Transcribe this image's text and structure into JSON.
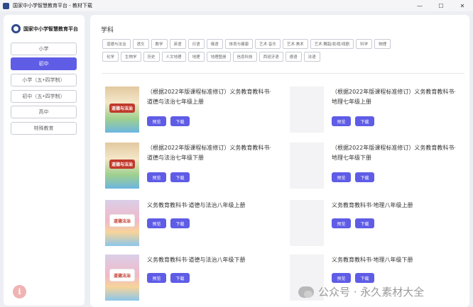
{
  "window": {
    "title": "国家中小学智慧教育平台 - 教材下载",
    "controls": {
      "minimize": "—",
      "maximize": "☐",
      "close": "✕"
    }
  },
  "sidebar": {
    "brand": "国家中小学智慧教育平台",
    "items": [
      {
        "label": "小学",
        "active": false
      },
      {
        "label": "初中",
        "active": true
      },
      {
        "label": "小学（五•四学制）",
        "active": false
      },
      {
        "label": "初中（五•四学制）",
        "active": false
      },
      {
        "label": "高中",
        "active": false
      },
      {
        "label": "特殊教育",
        "active": false
      }
    ],
    "info_icon": "i"
  },
  "main": {
    "section_title": "学科",
    "subject_row1": [
      "道德与法治",
      "语文",
      "数学",
      "英语",
      "日语",
      "俄语",
      "体育与健康",
      "艺术·音乐",
      "艺术·美术",
      "艺术·舞蹈/影视/戏剧",
      "科学",
      "物理"
    ],
    "subject_row2": [
      "化学",
      "生物学",
      "历史",
      "人文地理",
      "地理",
      "地理图册",
      "信息科技",
      "西班牙语",
      "德语",
      "法语"
    ],
    "books": [
      {
        "title": "（根据2022年版课程标准修订）义务教育教科书·道德与法治七年级上册",
        "cover_label": "道德与法治"
      },
      {
        "title": "（根据2022年版课程标准修订）义务教育教科书·地理七年级上册",
        "cover_label": ""
      },
      {
        "title": "（根据2022年版课程标准修订）义务教育教科书·道德与法治七年级下册",
        "cover_label": "道德与法治"
      },
      {
        "title": "（根据2022年版课程标准修订）义务教育教科书·地理七年级下册",
        "cover_label": ""
      },
      {
        "title": "义务教育教科书·道德与法治八年级上册",
        "cover_label": "道德法治"
      },
      {
        "title": "义务教育教科书·地理八年级上册",
        "cover_label": ""
      },
      {
        "title": "义务教育教科书·道德与法治八年级下册",
        "cover_label": "道德法治"
      },
      {
        "title": "义务教育教科书·地理八年级下册",
        "cover_label": ""
      }
    ],
    "preview_label": "预览",
    "download_label": "下载"
  },
  "watermark": {
    "text": "公众号 · 永久素材大全"
  },
  "colors": {
    "accent": "#5f5ce6",
    "background": "#eceef3",
    "panel": "#ffffff"
  }
}
